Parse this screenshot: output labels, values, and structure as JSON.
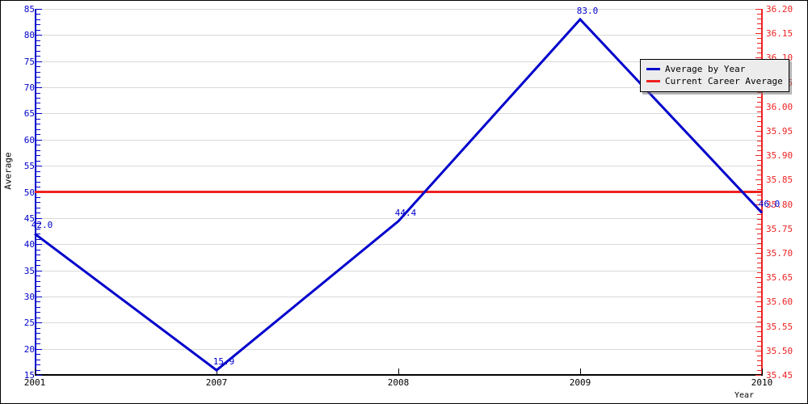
{
  "chart_data": {
    "type": "line",
    "title": "",
    "xlabel": "Year",
    "ylabel": "Average",
    "grid": true,
    "legend_position": "top-right",
    "x": [
      "2001",
      "2007",
      "2008",
      "2009",
      "2010"
    ],
    "categories": [
      "2001",
      "2007",
      "2008",
      "2009",
      "2010"
    ],
    "series": [
      {
        "name": "Average by Year",
        "color": "#0000cc",
        "values": [
          42.0,
          15.9,
          44.4,
          83.0,
          46.0
        ],
        "point_labels": [
          "42.0",
          "15.9",
          "44.4",
          "83.0",
          "46.0"
        ]
      },
      {
        "name": "Current Career Average",
        "color": "#ee2222",
        "type": "horizontal-line",
        "value": 50.0
      }
    ],
    "left_axis": {
      "color": "#0000cc",
      "label": "Average",
      "min": 15,
      "max": 85,
      "tick_step": 5,
      "ticks": [
        "15",
        "20",
        "25",
        "30",
        "35",
        "40",
        "45",
        "50",
        "55",
        "60",
        "65",
        "70",
        "75",
        "80",
        "85"
      ]
    },
    "right_axis": {
      "color": "#ee2222",
      "min": 35.45,
      "max": 36.2,
      "tick_step": 0.05,
      "ticks": [
        "35.45",
        "35.50",
        "35.55",
        "35.60",
        "35.65",
        "35.70",
        "35.75",
        "35.80",
        "35.85",
        "35.90",
        "35.95",
        "36.00",
        "36.05",
        "36.10",
        "36.15",
        "36.20"
      ]
    },
    "x_axis": {
      "color": "#000000",
      "label": "Year",
      "ticks": [
        "2001",
        "2007",
        "2008",
        "2009",
        "2010"
      ]
    }
  },
  "legend": {
    "items": [
      {
        "label": "Average by Year",
        "color": "#0000cc"
      },
      {
        "label": "Current Career Average",
        "color": "#ee2222"
      }
    ]
  }
}
